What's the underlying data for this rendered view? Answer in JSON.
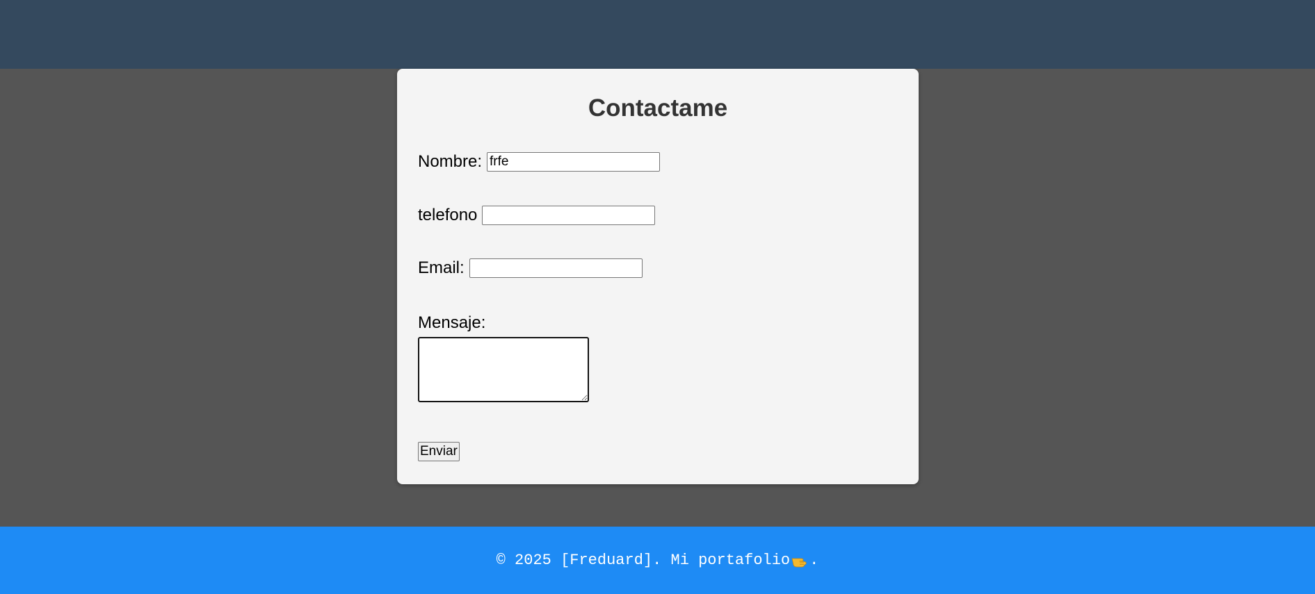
{
  "form": {
    "title": "Contactame",
    "nombre_label": "Nombre:",
    "nombre_value": "frfe",
    "telefono_label": "telefono",
    "telefono_value": "",
    "email_label": "Email:",
    "email_value": "",
    "mensaje_label": "Mensaje:",
    "mensaje_value": "",
    "submit_label": "Enviar"
  },
  "footer": {
    "text_before": "© 2025 [Freduard]. Mi portafolio",
    "icon": "pointing-hand-icon",
    "text_after": "."
  },
  "colors": {
    "header": "#34495e",
    "page_background": "#555555",
    "card_background": "#f4f4f4",
    "footer": "#1e8bf5"
  }
}
